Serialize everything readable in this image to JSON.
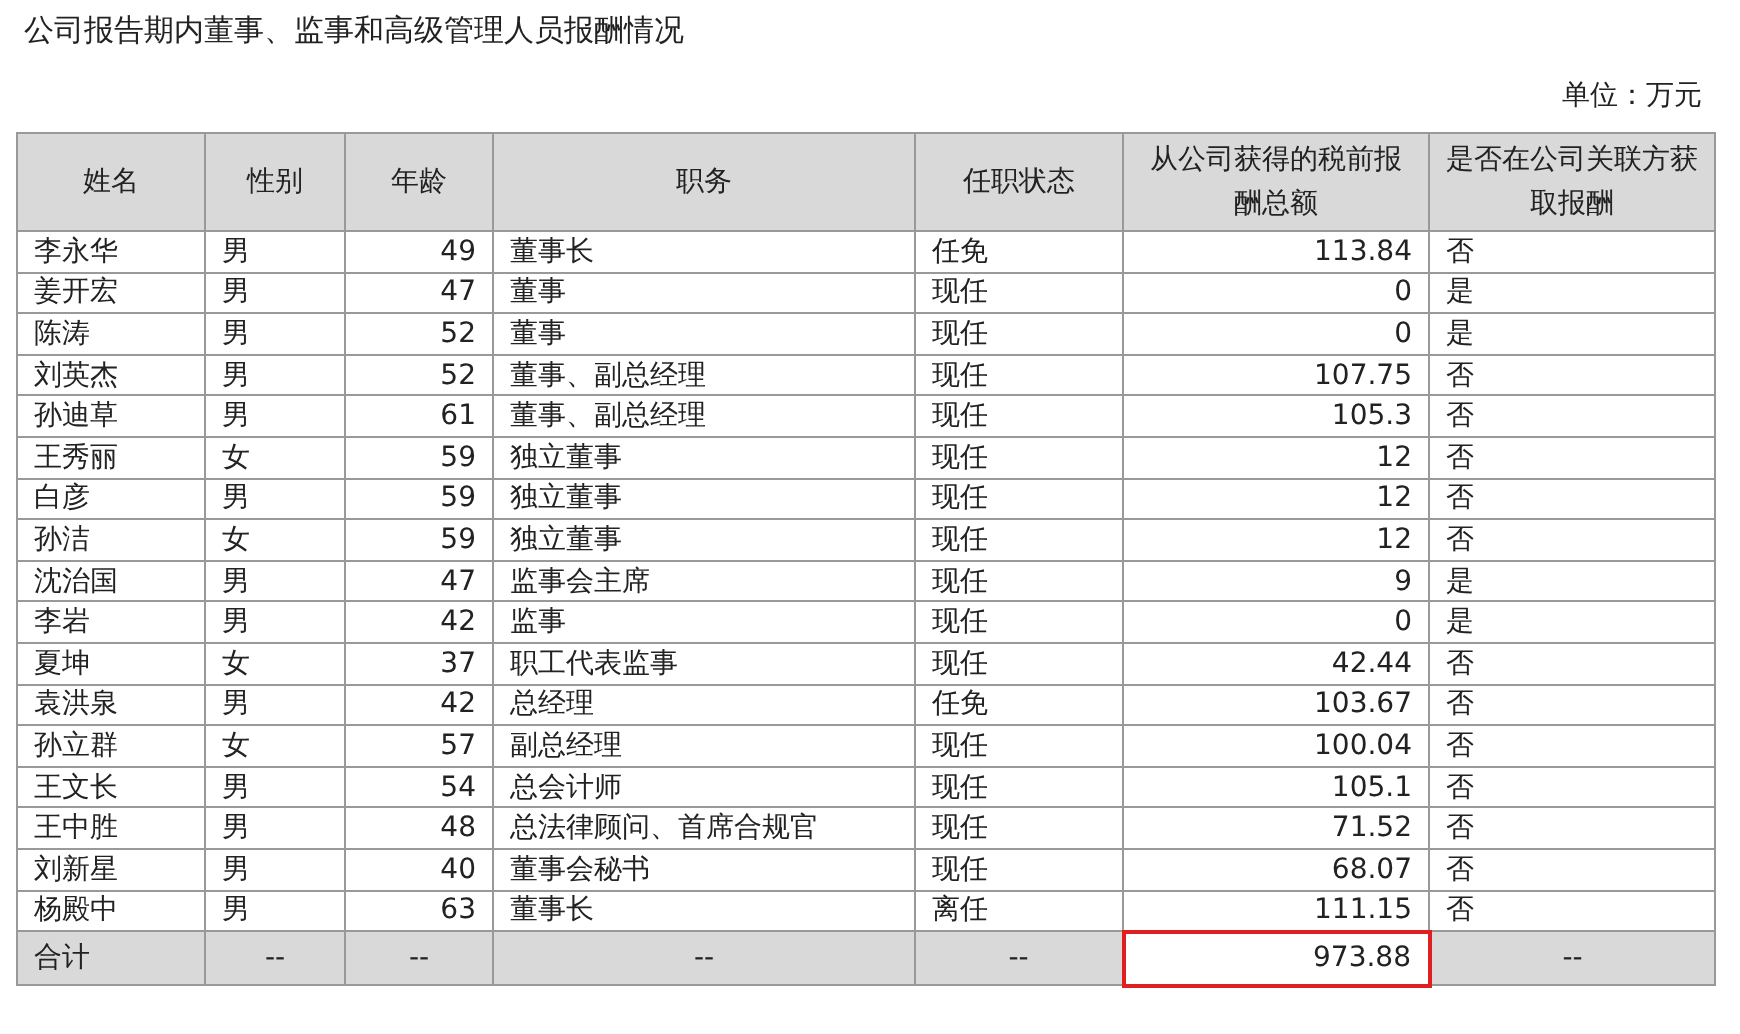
{
  "title": "公司报告期内董事、监事和高级管理人员报酬情况",
  "unit": "单位：万元",
  "table": {
    "columns": [
      "姓名",
      "性别",
      "年龄",
      "职务",
      "任职状态",
      "从公司获得的税前报酬总额",
      "是否在公司关联方获取报酬"
    ],
    "rows": [
      [
        "李永华",
        "男",
        "49",
        "董事长",
        "任免",
        "113.84",
        "否"
      ],
      [
        "姜开宏",
        "男",
        "47",
        "董事",
        "现任",
        "0",
        "是"
      ],
      [
        "陈涛",
        "男",
        "52",
        "董事",
        "现任",
        "0",
        "是"
      ],
      [
        "刘英杰",
        "男",
        "52",
        "董事、副总经理",
        "现任",
        "107.75",
        "否"
      ],
      [
        "孙迪草",
        "男",
        "61",
        "董事、副总经理",
        "现任",
        "105.3",
        "否"
      ],
      [
        "王秀丽",
        "女",
        "59",
        "独立董事",
        "现任",
        "12",
        "否"
      ],
      [
        "白彦",
        "男",
        "59",
        "独立董事",
        "现任",
        "12",
        "否"
      ],
      [
        "孙洁",
        "女",
        "59",
        "独立董事",
        "现任",
        "12",
        "否"
      ],
      [
        "沈治国",
        "男",
        "47",
        "监事会主席",
        "现任",
        "9",
        "是"
      ],
      [
        "李岩",
        "男",
        "42",
        "监事",
        "现任",
        "0",
        "是"
      ],
      [
        "夏坤",
        "女",
        "37",
        "职工代表监事",
        "现任",
        "42.44",
        "否"
      ],
      [
        "袁洪泉",
        "男",
        "42",
        "总经理",
        "任免",
        "103.67",
        "否"
      ],
      [
        "孙立群",
        "女",
        "57",
        "副总经理",
        "现任",
        "100.04",
        "否"
      ],
      [
        "王文长",
        "男",
        "54",
        "总会计师",
        "现任",
        "105.1",
        "否"
      ],
      [
        "王中胜",
        "男",
        "48",
        "总法律顾问、首席合规官",
        "现任",
        "71.52",
        "否"
      ],
      [
        "刘新星",
        "男",
        "40",
        "董事会秘书",
        "现任",
        "68.07",
        "否"
      ],
      [
        "杨殿中",
        "男",
        "63",
        "董事长",
        "离任",
        "111.15",
        "否"
      ]
    ],
    "total": [
      {
        "text": "合计",
        "highlighted": false
      },
      {
        "text": "--",
        "highlighted": false
      },
      {
        "text": "--",
        "highlighted": false
      },
      {
        "text": "--",
        "highlighted": false
      },
      {
        "text": "--",
        "highlighted": false
      },
      {
        "text": "973.88",
        "highlighted": true
      },
      {
        "text": "--",
        "highlighted": false
      }
    ]
  }
}
